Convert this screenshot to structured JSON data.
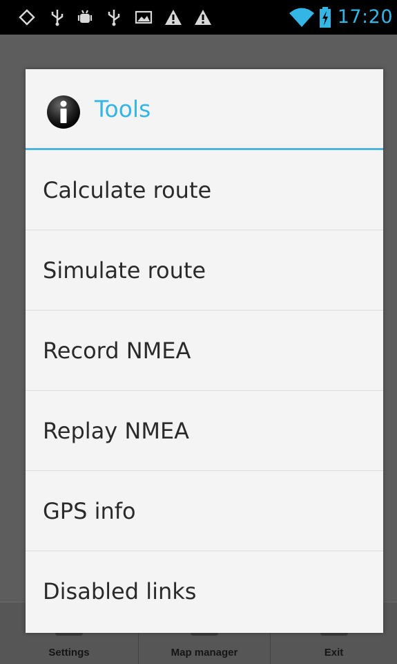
{
  "status_bar": {
    "time": "17:20",
    "icons": [
      "location-ring-icon",
      "usb-icon",
      "android-debug-icon",
      "usb-icon",
      "image-icon",
      "warning-icon",
      "warning-icon",
      "wifi-icon",
      "battery-charging-icon"
    ],
    "accent_color": "#33b5e5"
  },
  "dialog": {
    "title": "Tools",
    "icon": "info-icon",
    "accent_color": "#33b5e5",
    "items": [
      {
        "label": "Calculate route"
      },
      {
        "label": "Simulate route"
      },
      {
        "label": "Record NMEA"
      },
      {
        "label": "Replay NMEA"
      },
      {
        "label": "GPS info"
      },
      {
        "label": "Disabled links"
      }
    ]
  },
  "bottom_bar": {
    "items": [
      {
        "label": "Settings"
      },
      {
        "label": "Map manager"
      },
      {
        "label": "Exit"
      }
    ]
  }
}
